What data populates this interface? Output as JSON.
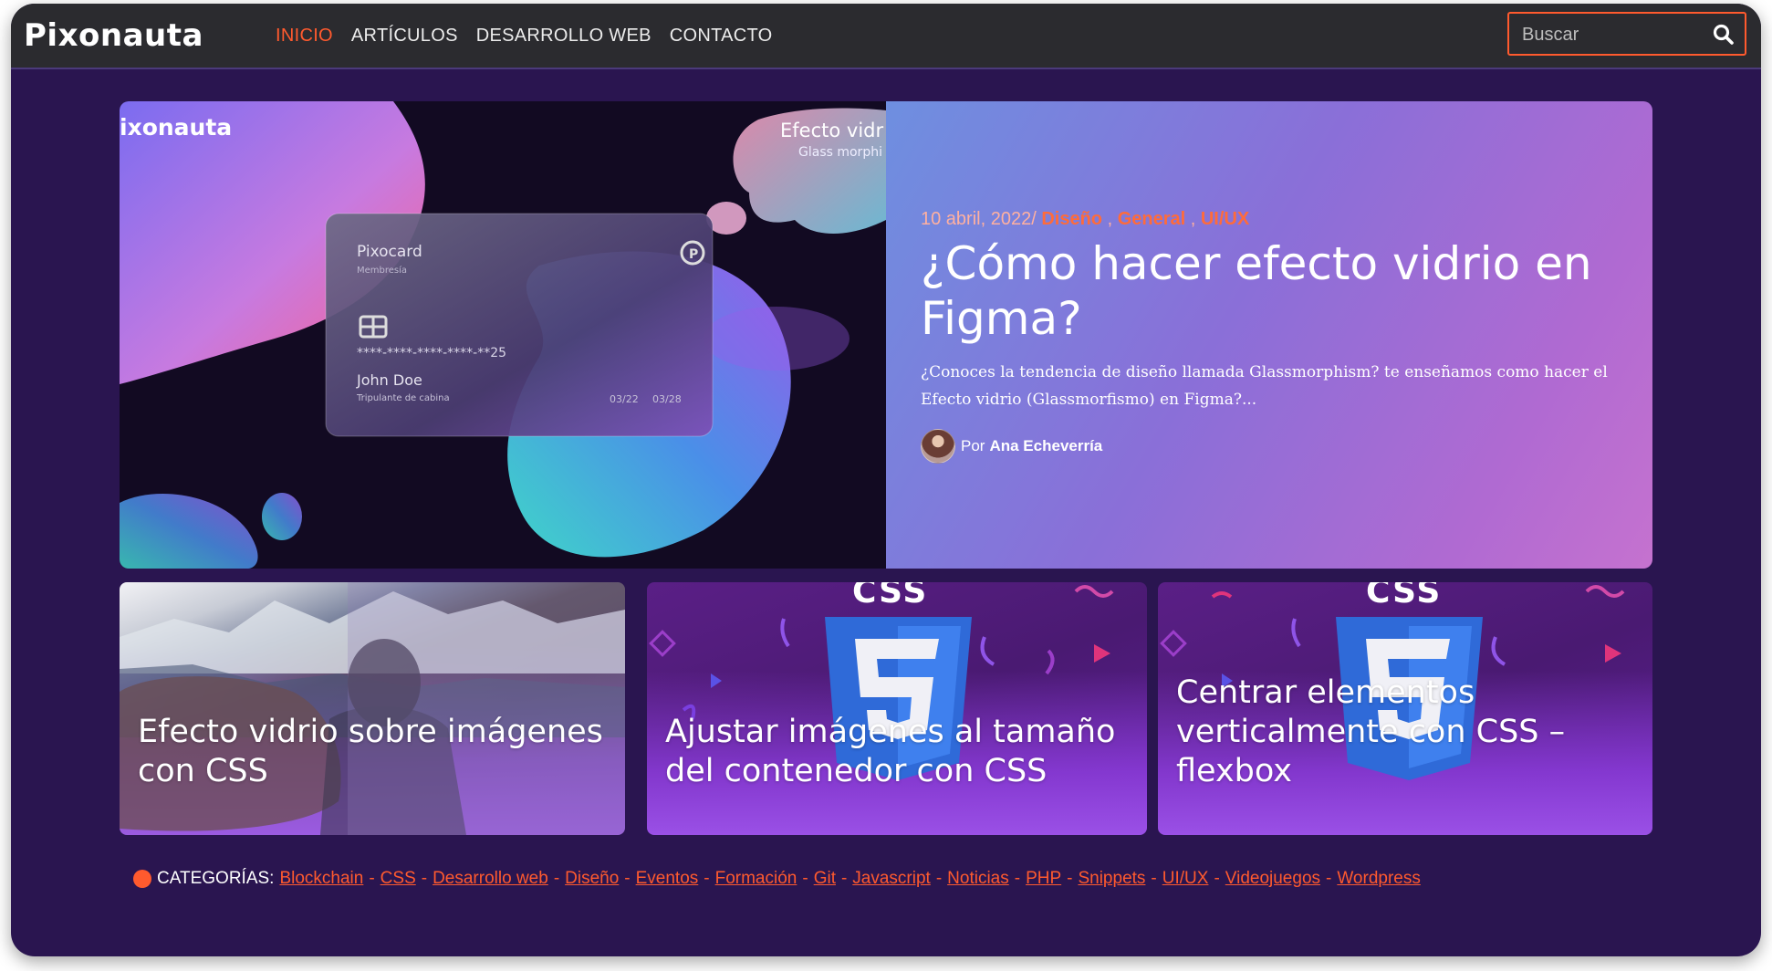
{
  "site": {
    "logo": "Pixonauta"
  },
  "nav": {
    "items": [
      {
        "label": "INICIO",
        "active": true
      },
      {
        "label": "ARTÍCULOS",
        "active": false
      },
      {
        "label": "DESARROLLO WEB",
        "active": false
      },
      {
        "label": "CONTACTO",
        "active": false
      }
    ]
  },
  "search": {
    "placeholder": "Buscar",
    "icon": "search-icon"
  },
  "featured": {
    "image": {
      "brand_text": "ixonauta",
      "banner_title": "Efecto vidr",
      "banner_sub": "Glass morphi",
      "card_brand": "Pixocard",
      "card_sub": "Membresía",
      "card_number": "****-****-****-****-**25",
      "card_holder": "John Doe",
      "card_role": "Tripulante de cabina",
      "card_date1": "03/22",
      "card_date2": "03/28"
    },
    "date": "10 abril, 2022/",
    "categories": [
      "Diseño",
      "General",
      "UI/UX"
    ],
    "title": "¿Cómo hacer efecto vidrio en Figma?",
    "excerpt": "¿Conoces la tendencia de diseño llamada Glassmorphism? te enseñamos como hacer el Efecto vidrio (Glassmorfismo) en Figma?...",
    "author_prefix": "Por",
    "author": "Ana Echeverría"
  },
  "cards": [
    {
      "title": "Efecto vidrio sobre imágenes con CSS"
    },
    {
      "title": "Ajustar imágenes al tamaño del contenedor con CSS",
      "badge": "CSS"
    },
    {
      "title": "Centrar elementos verticalmente con CSS – flexbox",
      "badge": "CSS"
    }
  ],
  "categories": {
    "label": "CATEGORÍAS:",
    "items": [
      "Blockchain",
      "CSS",
      "Desarrollo web",
      "Diseño",
      "Eventos",
      "Formación",
      "Git",
      "Javascript",
      "Noticias",
      "PHP",
      "Snippets",
      "UI/UX",
      "Videojuegos",
      "Wordpress"
    ]
  },
  "colors": {
    "accent": "#ff5a2e",
    "background": "#2a1550",
    "nav": "#2b2b2f"
  }
}
